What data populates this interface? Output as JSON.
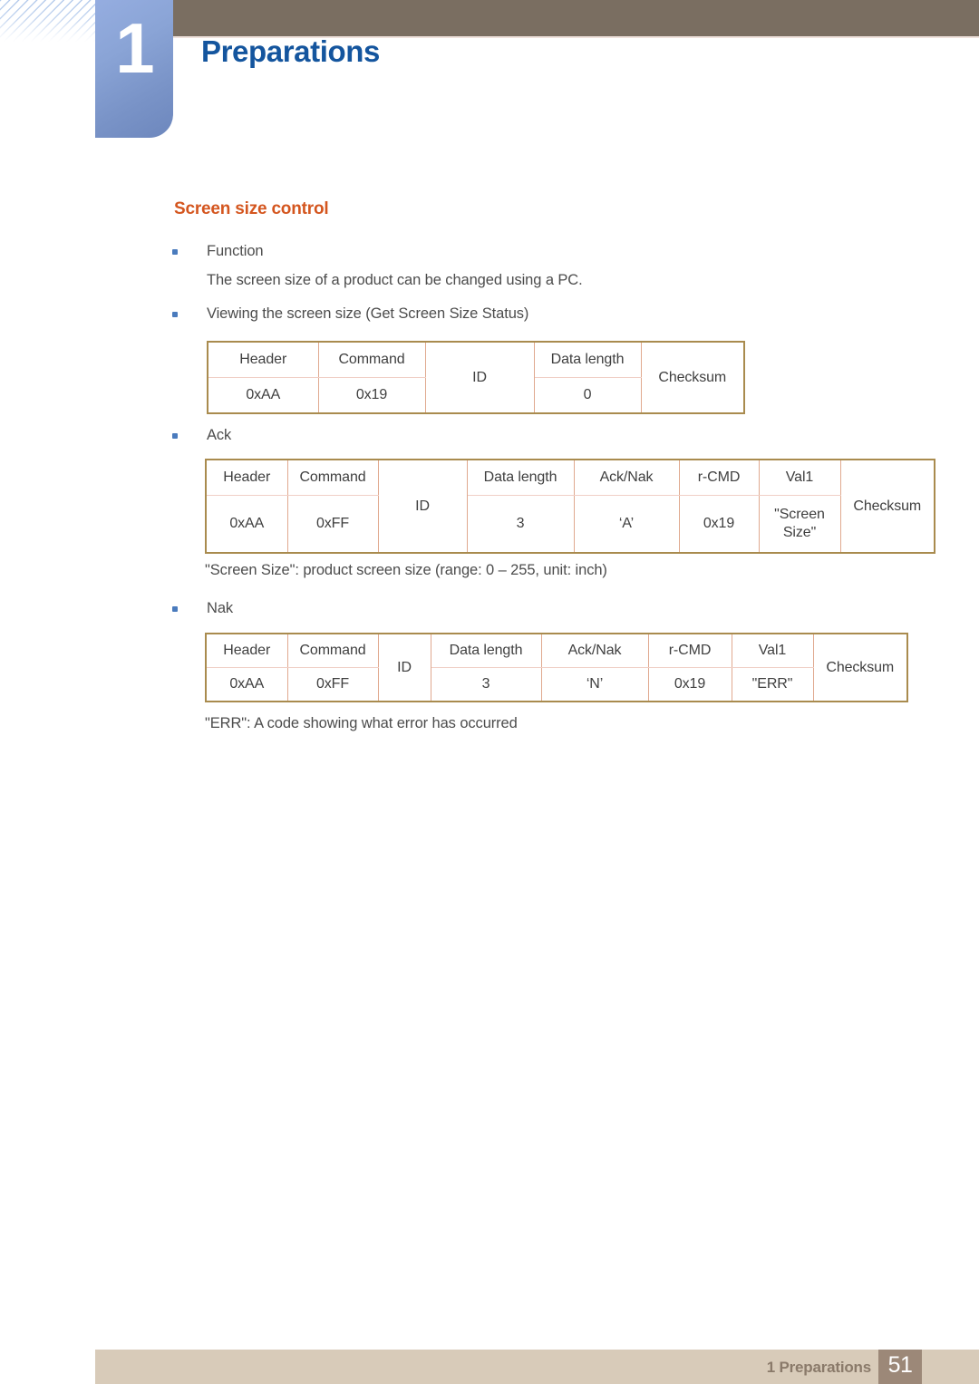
{
  "header": {
    "chapter_number": "1",
    "chapter_title": "Preparations",
    "accent_blue": "#14559e",
    "tab_blue": "#8aa4d6",
    "bar_brown": "#7a6e61"
  },
  "section": {
    "title": "Screen size control",
    "title_color": "#d4561f"
  },
  "body": {
    "bullet_function": "Function",
    "function_description": "The screen size of a product can be changed using a PC.",
    "bullet_viewing": "Viewing the screen size (Get Screen Size Status)",
    "bullet_ack": "Ack",
    "note_screen_size": "\"Screen Size\": product screen size (range: 0 – 255, unit: inch)",
    "bullet_nak": "Nak",
    "note_err": "\"ERR\": A code showing what error has occurred"
  },
  "tables": {
    "get_status": {
      "headers": [
        "Header",
        "Command",
        "ID",
        "Data length",
        "Checksum"
      ],
      "values": [
        "0xAA",
        "0x19",
        "",
        "0",
        ""
      ]
    },
    "ack": {
      "headers": [
        "Header",
        "Command",
        "ID",
        "Data length",
        "Ack/Nak",
        "r-CMD",
        "Val1",
        "Checksum"
      ],
      "values": [
        "0xAA",
        "0xFF",
        "",
        "3",
        "‘A’",
        "0x19",
        "\"Screen Size\"",
        ""
      ]
    },
    "nak": {
      "headers": [
        "Header",
        "Command",
        "ID",
        "Data length",
        "Ack/Nak",
        "r-CMD",
        "Val1",
        "Checksum"
      ],
      "values": [
        "0xAA",
        "0xFF",
        "",
        "3",
        "‘N’",
        "0x19",
        "\"ERR\"",
        ""
      ]
    }
  },
  "footer": {
    "label": "1 Preparations",
    "page_number": "51",
    "bar_color": "#d8cbb9",
    "page_box_color": "#9c8878"
  }
}
